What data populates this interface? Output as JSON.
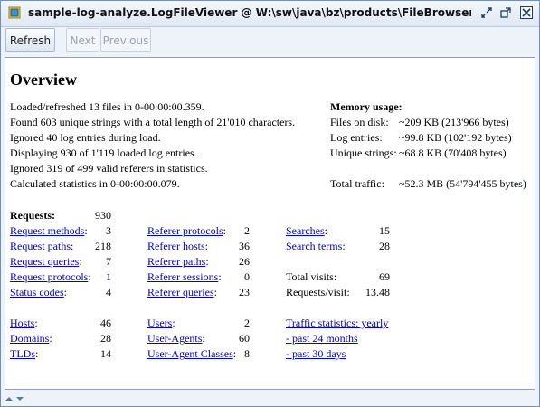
{
  "window": {
    "title": "sample-log-analyze.LogFileViewer @ W:\\sw\\java\\bz\\products\\FileBrowser\\binary\\sam..."
  },
  "toolbar": {
    "refresh_label": "Refresh",
    "next_label": "Next",
    "previous_label": "Previous"
  },
  "overview": {
    "heading": "Overview",
    "log_lines": [
      "Loaded/refreshed 13 files in 0-00:00:00.359.",
      "Found 603 unique strings with a total length of 21'010 characters.",
      "Ignored 40 log entries during load.",
      "Displaying 930 of 1'119 loaded log entries.",
      "Ignored 319 of 499 valid referers in statistics.",
      "Calculated statistics in 0-00:00:00.079."
    ],
    "memory": {
      "heading": "Memory usage:",
      "rows": [
        {
          "label": "Files on disk:",
          "value": "~209 KB (213'966 bytes)"
        },
        {
          "label": "Log entries:",
          "value": "~99.8 KB (102'192 bytes)"
        },
        {
          "label": "Unique strings:",
          "value": "~68.8 KB (70'408 bytes)"
        }
      ],
      "traffic": {
        "label": "Total traffic:",
        "value": "~52.3 MB (54'794'455 bytes)"
      }
    }
  },
  "stats": {
    "requests_label": "Requests:",
    "requests_value": "930",
    "col1": [
      {
        "label": "Request methods",
        "suffix": ":",
        "value": "3"
      },
      {
        "label": "Request paths",
        "suffix": ":",
        "value": "218"
      },
      {
        "label": "Request queries",
        "suffix": ":",
        "value": "7"
      },
      {
        "label": "Request protocols",
        "suffix": ":",
        "value": "1"
      },
      {
        "label": "Status codes",
        "suffix": ":",
        "value": "4"
      }
    ],
    "col2": [
      {
        "label": "Referer protocols",
        "suffix": ":",
        "value": "2"
      },
      {
        "label": "Referer hosts",
        "suffix": ":",
        "value": "36"
      },
      {
        "label": "Referer paths",
        "suffix": ":",
        "value": "26"
      },
      {
        "label": "Referer sessions",
        "suffix": ":",
        "value": "0"
      },
      {
        "label": "Referer queries",
        "suffix": ":",
        "value": "23"
      }
    ],
    "col3_links": [
      {
        "label": "Searches",
        "suffix": ":",
        "value": "15"
      },
      {
        "label": "Search terms",
        "suffix": ":",
        "value": "28"
      }
    ],
    "total_visits": {
      "label": "Total visits:",
      "value": "69"
    },
    "requests_per_visit": {
      "label": "Requests/visit:",
      "value": "13.48"
    },
    "col1b": [
      {
        "label": "Hosts",
        "suffix": ":",
        "value": "46"
      },
      {
        "label": "Domains",
        "suffix": ":",
        "value": "28"
      },
      {
        "label": "TLDs",
        "suffix": ":",
        "value": "14"
      }
    ],
    "col2b": [
      {
        "label": "Users",
        "suffix": ":",
        "value": "2"
      },
      {
        "label": "User-Agents",
        "suffix": ":",
        "value": "60"
      },
      {
        "label": "User-Agent Classes",
        "suffix": ":",
        "value": "8"
      }
    ],
    "traffic_links": [
      "Traffic statistics: yearly",
      "- past 24 months",
      "- past 30 days"
    ]
  },
  "icons": {
    "app": "app-icon",
    "minimize": "minimize-icon",
    "maximize": "maximize-icon",
    "close": "close-icon",
    "corner": "resize-arrows-icon"
  }
}
